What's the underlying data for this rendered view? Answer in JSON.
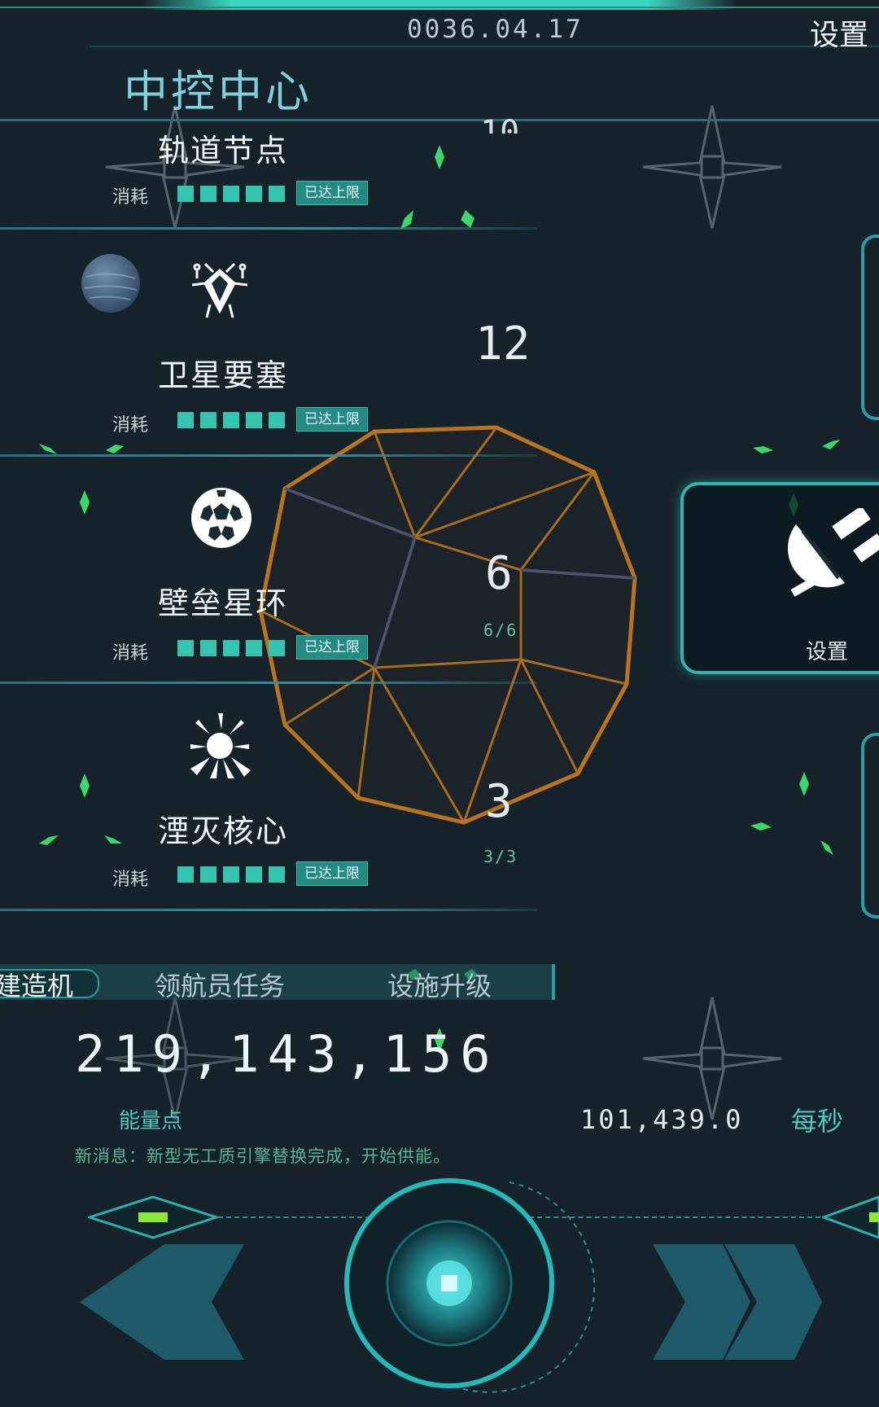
{
  "header": {
    "date": "0036.04.17",
    "settings_label": "设置",
    "title": "中控中心"
  },
  "buildings": [
    {
      "name": "轨道节点",
      "cost_label": "消耗",
      "pips": 5,
      "badge": "已达上限",
      "count": "",
      "count_sub": "",
      "icon": "orbital-node-icon"
    },
    {
      "name": "卫星要塞",
      "cost_label": "消耗",
      "pips": 5,
      "badge": "已达上限",
      "count": "12",
      "count_sub": "",
      "icon": "satellite-fortress-icon"
    },
    {
      "name": "壁垒星环",
      "cost_label": "消耗",
      "pips": 5,
      "badge": "已达上限",
      "count": "6",
      "count_sub": "6/6",
      "icon": "bastion-ring-icon"
    },
    {
      "name": "湮灭核心",
      "cost_label": "消耗",
      "pips": 5,
      "badge": "已达上限",
      "count": "3",
      "count_sub": "3/3",
      "icon": "annihilation-core-icon"
    }
  ],
  "side_panel": {
    "label": "设置",
    "icon": "satellite-dish-icon"
  },
  "tabs": [
    {
      "label": "建造机",
      "active": true
    },
    {
      "label": "领航员任务",
      "active": false
    },
    {
      "label": "设施升级",
      "active": false
    }
  ],
  "energy": {
    "value": "219,143,156",
    "label": "能量点",
    "rate": "101,439.0",
    "rate_unit": "每秒"
  },
  "news": "新消息：新型无工质引擎替换完成，开始供能。",
  "controls": {
    "prev_icon": "double-chevron-left-icon",
    "next_icon": "double-chevron-right-icon",
    "center_icon": "core-button-icon"
  },
  "colors": {
    "accent": "#34c4b0",
    "panel_border": "#2fb4b0",
    "background": "#17232b",
    "news": "#57b590"
  }
}
